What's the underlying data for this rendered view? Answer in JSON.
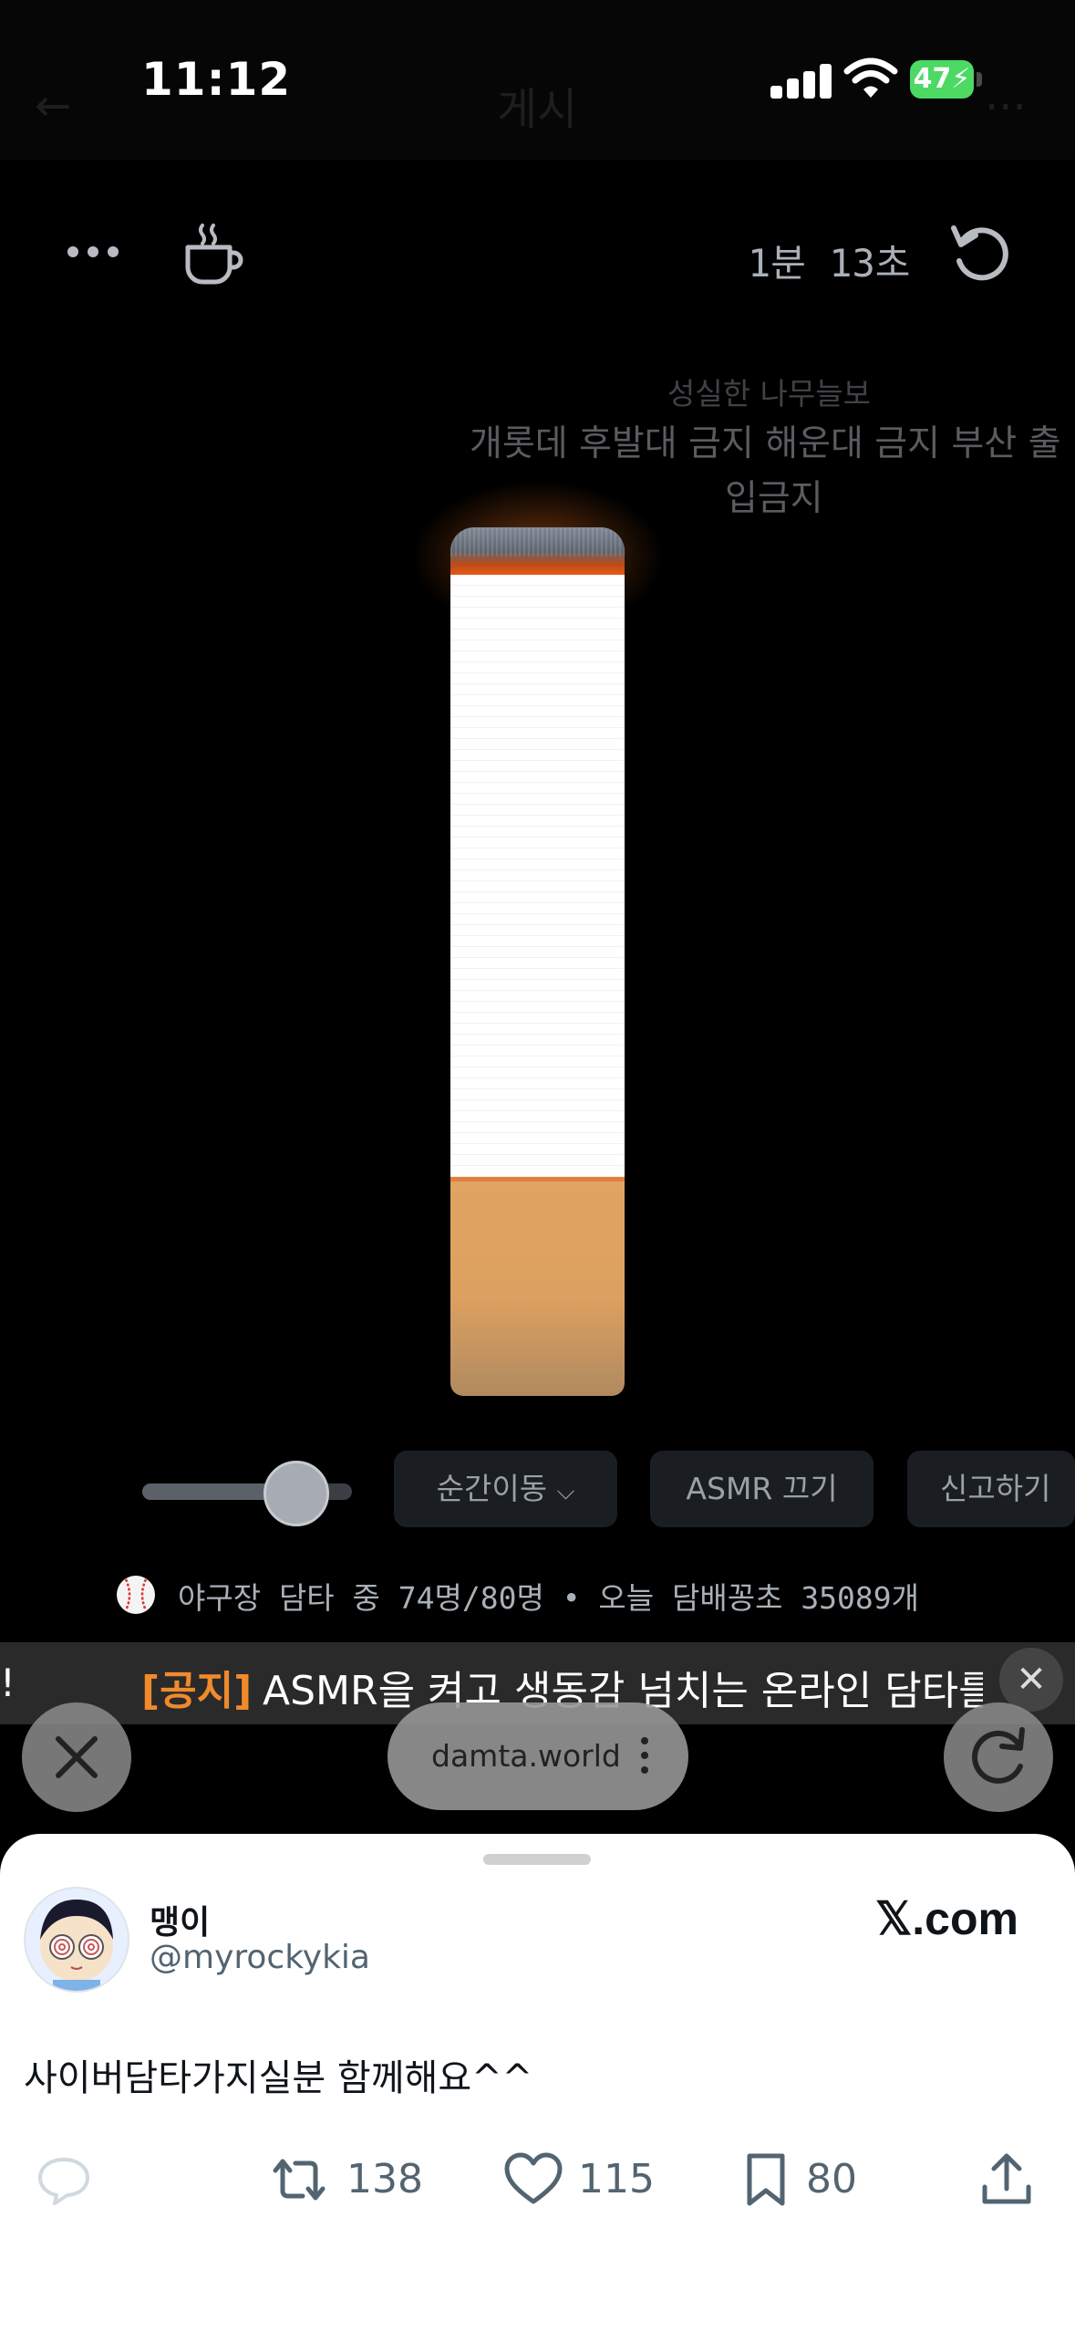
{
  "status_bar": {
    "time": "11:12",
    "battery": "47",
    "underlying_title": "게시",
    "underlying_back": "←",
    "underlying_more": "···"
  },
  "timer": {
    "text": "1분 13초"
  },
  "message": {
    "author": "성실한 나무늘보",
    "line1": "개롯데 후발대 금지 해운대 금지 부산 출",
    "line2": "입금지"
  },
  "controls": {
    "volume_level": 0.72,
    "teleport_label": "순간이동",
    "asmr_label": "ASMR 끄기",
    "report_label": "신고하기"
  },
  "stats": {
    "text": "야구장 담타 중 74명/80명 • 오늘 담배꽁초 35089개"
  },
  "notice": {
    "tag": "[공지]",
    "text": "ASMR을 켜고 생동감 넘치는 온라인 담타를",
    "leading": "!"
  },
  "browser": {
    "url": "damta.world"
  },
  "tweet": {
    "display_name": "맹이",
    "handle": "@myrockykia",
    "site": "𝕏.com",
    "text": "사이버담타가지실분 함께해요^^",
    "retweets": "138",
    "likes": "115",
    "bookmarks": "80"
  },
  "colors": {
    "notice_tag": "#f08a2c",
    "background": "#000000",
    "sheet": "#ffffff"
  }
}
